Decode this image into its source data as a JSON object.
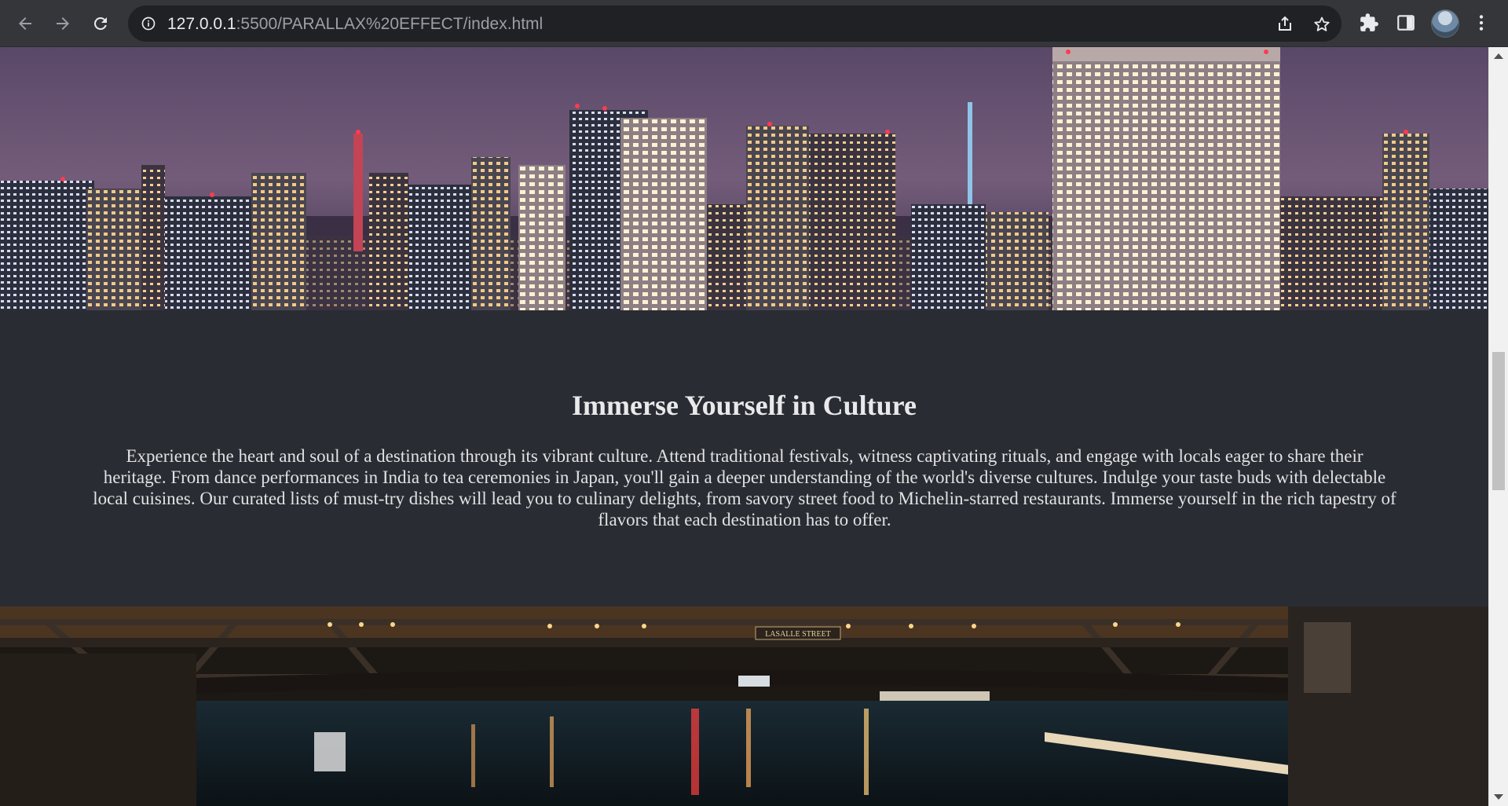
{
  "browser": {
    "url_host": "127.0.0.1",
    "url_rest": ":5500/PARALLAX%20EFFECT/index.html",
    "icons": {
      "back": "back-arrow-icon",
      "forward": "forward-arrow-icon",
      "reload": "reload-icon",
      "info": "info-icon",
      "share": "share-icon",
      "bookmark": "star-icon",
      "extensions": "puzzle-icon",
      "side_panel": "side-panel-icon",
      "profile": "avatar",
      "menu": "kebab-menu-icon"
    }
  },
  "page": {
    "section": {
      "heading": "Immerse Yourself in Culture",
      "body": "Experience the heart and soul of a destination through its vibrant culture. Attend traditional festivals, witness captivating rituals, and engage with locals eager to share their heritage. From dance performances in India to tea ceremonies in Japan, you'll gain a deeper understanding of the world's diverse cultures. Indulge your taste buds with delectable local cuisines. Our curated lists of must-try dishes will lead you to culinary delights, from savory street food to Michelin-starred restaurants. Immerse yourself in the rich tapestry of flavors that each destination has to offer."
    },
    "bridge_sign": "LASALLE STREET",
    "images": {
      "top": "night-city-skyline",
      "bottom": "river-bridge-night"
    }
  },
  "colors": {
    "chrome": "#35363a",
    "omnibox": "#202124",
    "section_bg": "#292c33",
    "text": "#e9e9ea"
  }
}
